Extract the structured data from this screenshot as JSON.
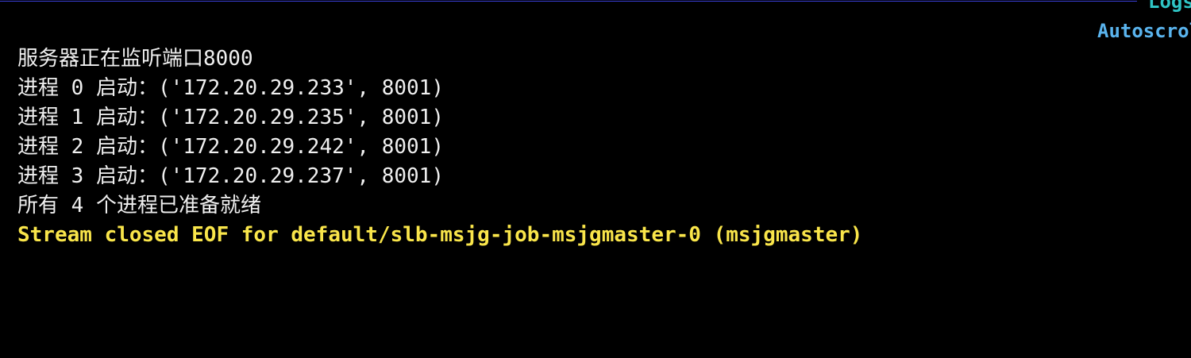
{
  "header": {
    "logs_label": "Logs",
    "autoscroll_label": "Autoscroll"
  },
  "log": {
    "lines": [
      "服务器正在监听端口8000",
      "进程 0 启动：('172.20.29.233', 8001)",
      "进程 1 启动：('172.20.29.235', 8001)",
      "进程 2 启动：('172.20.29.242', 8001)",
      "进程 3 启动：('172.20.29.237', 8001)",
      "所有 4 个进程已准备就绪"
    ],
    "status_line": "Stream closed EOF for default/slb-msjg-job-msjgmaster-0 (msjgmaster)"
  },
  "colors": {
    "background": "#000000",
    "text": "#f0f0f0",
    "status": "#f9e54a",
    "logs_label": "#2ec4c4",
    "autoscroll_label": "#5ab4ee",
    "rule": "#3a3fd6"
  }
}
